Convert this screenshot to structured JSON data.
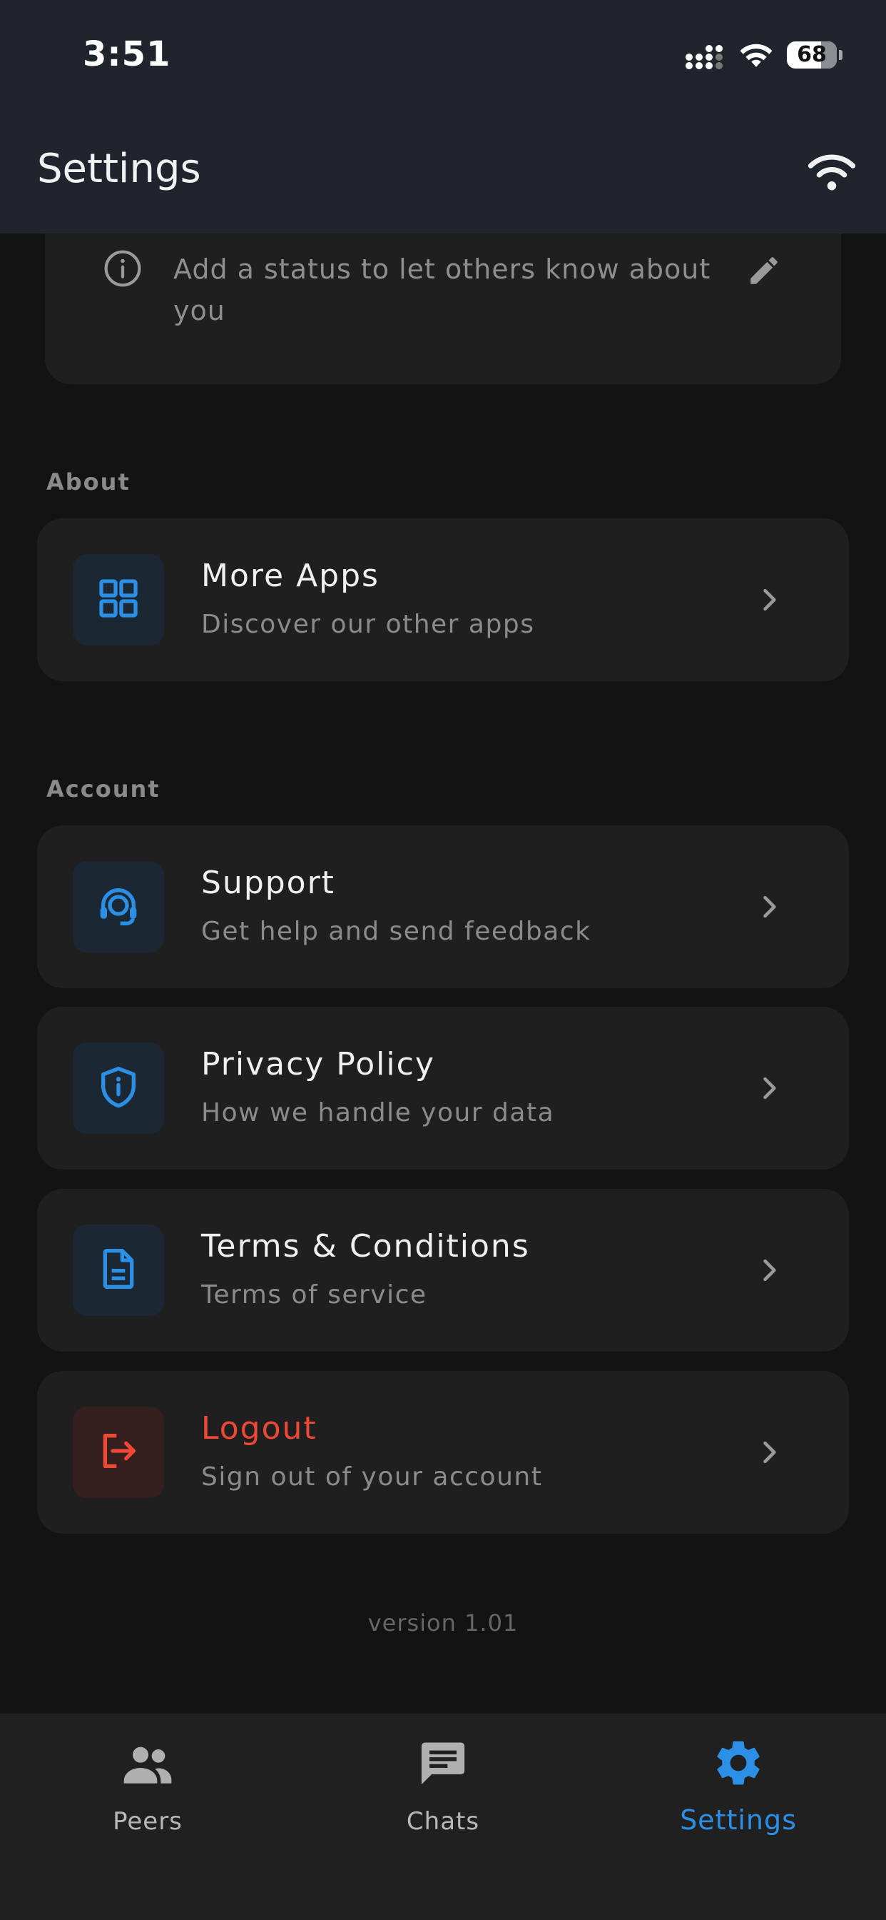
{
  "status_bar": {
    "time": "3:51",
    "battery_level": "68",
    "battery_fraction": 0.68
  },
  "header": {
    "title": "Settings"
  },
  "status_card": {
    "text": "Add a status to let others know about you"
  },
  "sections": {
    "about": "About",
    "account": "Account"
  },
  "rows": {
    "more_apps": {
      "title": "More Apps",
      "subtitle": "Discover our other apps",
      "icon": "grid-icon"
    },
    "support": {
      "title": "Support",
      "subtitle": "Get help and send feedback",
      "icon": "headset-icon"
    },
    "privacy": {
      "title": "Privacy Policy",
      "subtitle": "How we handle your data",
      "icon": "shield-info-icon"
    },
    "terms": {
      "title": "Terms & Conditions",
      "subtitle": "Terms of service",
      "icon": "document-icon"
    },
    "logout": {
      "title": "Logout",
      "subtitle": "Sign out of your account",
      "icon": "logout-icon"
    }
  },
  "version": "version 1.01",
  "tabs": [
    {
      "label": "Peers",
      "icon": "people-icon",
      "active": false
    },
    {
      "label": "Chats",
      "icon": "chat-icon",
      "active": false
    },
    {
      "label": "Settings",
      "icon": "gear-icon",
      "active": true
    }
  ],
  "colors": {
    "accent": "#2b8fe6",
    "danger": "#ef4836",
    "header_bg": "#1f242d",
    "page_bg": "#131313",
    "card_bg": "#1f1f1f"
  }
}
